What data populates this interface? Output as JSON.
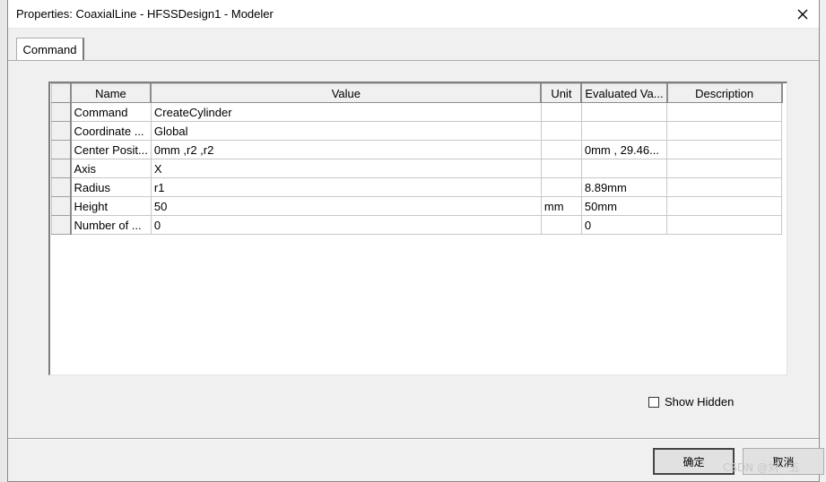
{
  "window": {
    "title": "Properties: CoaxialLine - HFSSDesign1 - Modeler"
  },
  "tabs": [
    {
      "label": "Command"
    }
  ],
  "grid": {
    "columns": [
      "Name",
      "Value",
      "Unit",
      "Evaluated Va...",
      "Description"
    ],
    "rows": [
      {
        "name": "Command",
        "value": "CreateCylinder",
        "unit": "",
        "evaluated": "",
        "description": ""
      },
      {
        "name": "Coordinate ...",
        "value": "Global",
        "unit": "",
        "evaluated": "",
        "description": ""
      },
      {
        "name": "Center Posit...",
        "value": "0mm ,r2 ,r2",
        "unit": "",
        "evaluated": "0mm , 29.46...",
        "description": ""
      },
      {
        "name": "Axis",
        "value": "X",
        "unit": "",
        "evaluated": "",
        "description": ""
      },
      {
        "name": "Radius",
        "value": "r1",
        "unit": "",
        "evaluated": "8.89mm",
        "description": ""
      },
      {
        "name": "Height",
        "value": "50",
        "unit": "mm",
        "evaluated": "50mm",
        "description": ""
      },
      {
        "name": "Number of ...",
        "value": "0",
        "unit": "",
        "evaluated": "0",
        "description": ""
      }
    ]
  },
  "options": {
    "show_hidden_label": "Show Hidden",
    "show_hidden_checked": false
  },
  "buttons": {
    "ok_label": "确定",
    "cancel_label": "取消"
  },
  "watermark": "CSDN @刘一五"
}
